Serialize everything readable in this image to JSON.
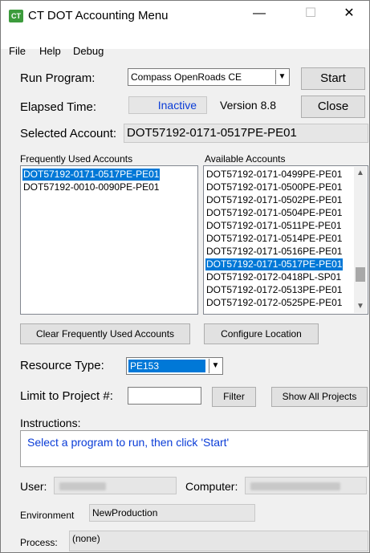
{
  "window": {
    "title": "CT DOT Accounting Menu",
    "icon": "ctdot-app-icon"
  },
  "titlebar": {
    "minimize": "—",
    "maximize": "☐",
    "close": "✕"
  },
  "menu": [
    "File",
    "Help",
    "Debug"
  ],
  "run_program": {
    "label": "Run Program:",
    "value": "Compass OpenRoads CE",
    "start_button": "Start"
  },
  "elapsed": {
    "label": "Elapsed Time:",
    "status": "Inactive",
    "version": "Version 8.8",
    "close_button": "Close"
  },
  "selected_account": {
    "label": "Selected Account:",
    "value": "DOT57192-0171-0517PE-PE01"
  },
  "frequent": {
    "label": "Frequently Used Accounts",
    "items": [
      "DOT57192-0171-0517PE-PE01",
      "DOT57192-0010-0090PE-PE01"
    ],
    "selected_index": 0,
    "clear_button": "Clear Frequently Used Accounts"
  },
  "available": {
    "label": "Available Accounts",
    "items": [
      "DOT57192-0171-0499PE-PE01",
      "DOT57192-0171-0500PE-PE01",
      "DOT57192-0171-0502PE-PE01",
      "DOT57192-0171-0504PE-PE01",
      "DOT57192-0171-0511PE-PE01",
      "DOT57192-0171-0514PE-PE01",
      "DOT57192-0171-0516PE-PE01",
      "DOT57192-0171-0517PE-PE01",
      "DOT57192-0172-0418PL-SP01",
      "DOT57192-0172-0513PE-PE01",
      "DOT57192-0172-0525PE-PE01"
    ],
    "selected_index": 7,
    "configure_button": "Configure Location"
  },
  "resource_type": {
    "label": "Resource Type:",
    "value": "PE153"
  },
  "limit": {
    "label": "Limit to Project #:",
    "value": "",
    "filter_button": "Filter",
    "show_all_button": "Show All Projects"
  },
  "instructions": {
    "label": "Instructions:",
    "text": "Select a program to run, then click 'Start'"
  },
  "user": {
    "label": "User:",
    "computer_label": "Computer:"
  },
  "environment": {
    "label": "Environment",
    "value": "NewProduction"
  },
  "process": {
    "label": "Process:",
    "value": "(none)"
  },
  "colors": {
    "selection": "#0078d7",
    "status_blue": "#0a3cd7",
    "instructions_blue": "#0a3cd7"
  }
}
